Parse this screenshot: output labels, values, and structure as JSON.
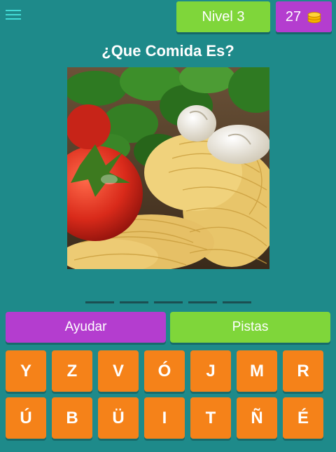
{
  "header": {
    "level_label": "Nivel 3",
    "coins": "27"
  },
  "question": "¿Que Comida Es?",
  "answer": {
    "slots": 5
  },
  "actions": {
    "help_label": "Ayudar",
    "hints_label": "Pistas"
  },
  "keyboard": {
    "rows": [
      [
        "Y",
        "Z",
        "V",
        "Ó",
        "J",
        "M",
        "R"
      ],
      [
        "Ú",
        "B",
        "Ü",
        "I",
        "T",
        "Ñ",
        "É"
      ]
    ]
  },
  "icons": {
    "menu": "menu-icon",
    "coins": "coin-stack-icon"
  },
  "colors": {
    "background": "#1e8a8a",
    "level_badge": "#7fd63a",
    "coins_badge": "#b43dcf",
    "help_button": "#b43dcf",
    "hints_button": "#7fd63a",
    "key": "#f58219",
    "menu_icon": "#43dbd6"
  }
}
